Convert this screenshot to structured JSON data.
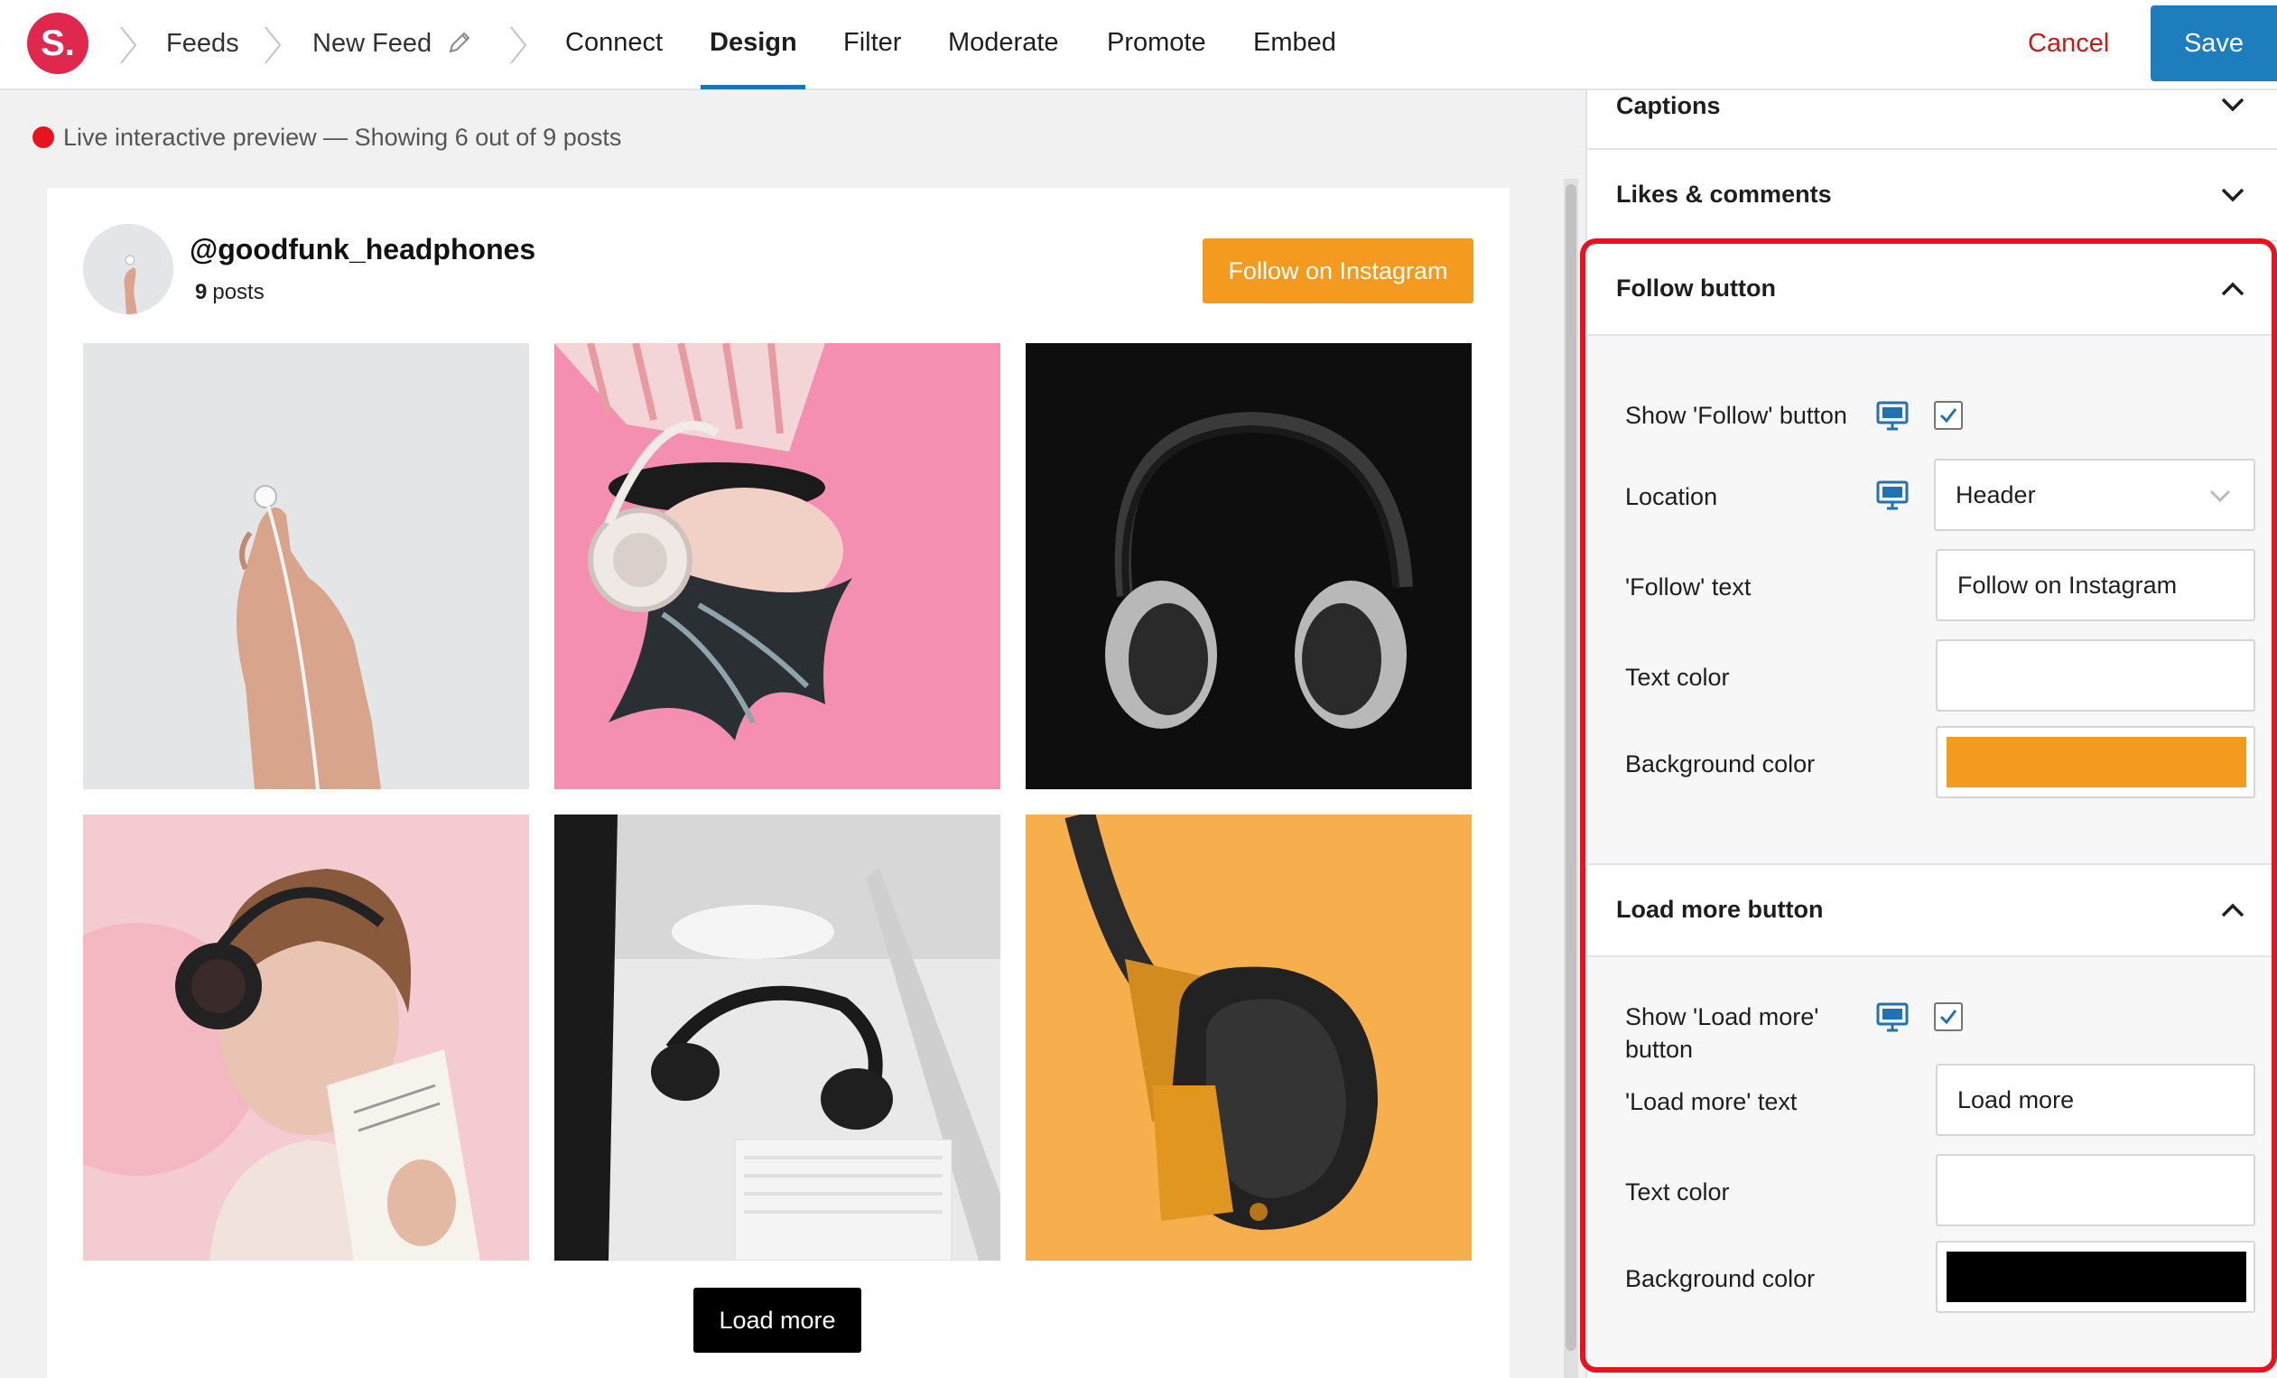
{
  "topbar": {
    "logo_text": "S.",
    "breadcrumbs": [
      "Feeds",
      "New Feed"
    ],
    "tabs": [
      "Connect",
      "Design",
      "Filter",
      "Moderate",
      "Promote",
      "Embed"
    ],
    "active_tab": "Design",
    "cancel_label": "Cancel",
    "save_label": "Save"
  },
  "preview": {
    "status_text": "Live interactive preview — Showing 6 out of 9 posts",
    "username": "@goodfunk_headphones",
    "post_count": "9",
    "post_count_label": "posts",
    "follow_button_label": "Follow on Instagram",
    "load_more_label": "Load more",
    "photos": [
      "earbuds-hand",
      "woman-white-headphones-pink",
      "silver-headphones-black",
      "woman-black-headphones-book",
      "headphones-desk-keyboard",
      "orange-headphones"
    ]
  },
  "sidebar": {
    "captions_title": "Captions",
    "likes_title": "Likes & comments",
    "follow_section": {
      "title": "Follow button",
      "show_label": "Show 'Follow' button",
      "show_checked": true,
      "location_label": "Location",
      "location_value": "Header",
      "text_label": "'Follow' text",
      "text_value": "Follow on Instagram",
      "text_color_label": "Text color",
      "bg_color_label": "Background color",
      "bg_color": "#f49a1f"
    },
    "load_more_section": {
      "title": "Load more button",
      "show_label": "Show 'Load more' button",
      "show_checked": true,
      "text_label": "'Load more' text",
      "text_value": "Load more",
      "text_color_label": "Text color",
      "bg_color_label": "Background color",
      "bg_color": "#000000"
    }
  },
  "colors": {
    "accent_blue": "#2271b1",
    "save_blue": "#1d7dbd",
    "logo_red": "#e0284f",
    "cancel_red": "#cc1818",
    "highlight_red": "#e8131f",
    "follow_orange": "#f49a1f"
  }
}
